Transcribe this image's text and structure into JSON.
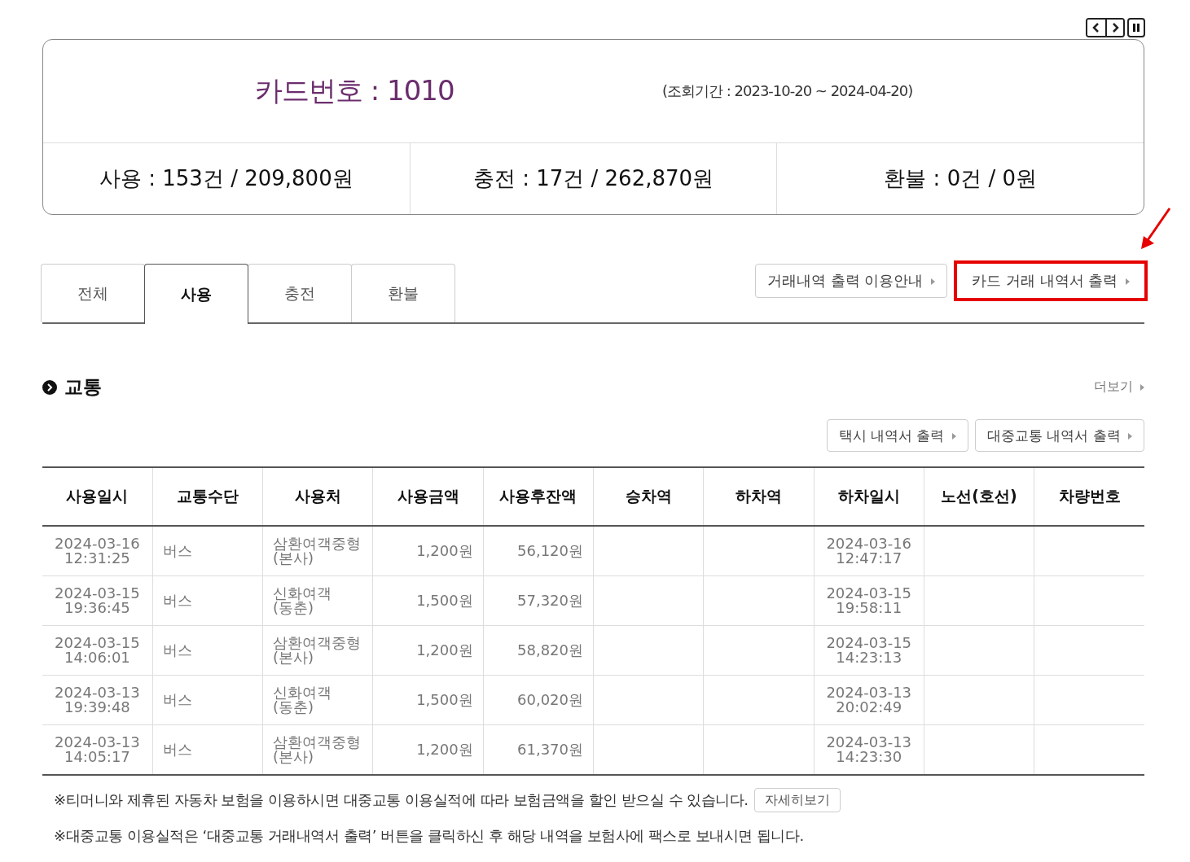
{
  "summary": {
    "card_label": "카드번호 : 1010",
    "period": "(조회기간 : 2023-10-20 ~ 2024-04-20)",
    "stats": [
      "사용 : 153건 / 209,800원",
      "충전 : 17건 / 262,870원",
      "환불 : 0건 / 0원"
    ]
  },
  "tabs": [
    {
      "label": "전체",
      "selected": false
    },
    {
      "label": "사용",
      "selected": true
    },
    {
      "label": "충전",
      "selected": false
    },
    {
      "label": "환불",
      "selected": false
    }
  ],
  "top_buttons": [
    {
      "label": "거래내역 출력 이용안내",
      "highlighted": false
    },
    {
      "label": "카드 거래 내역서 출력",
      "highlighted": true
    }
  ],
  "section": {
    "title": "교통",
    "more": "더보기"
  },
  "print_buttons": [
    "택시 내역서 출력",
    "대중교통 내역서 출력"
  ],
  "table": {
    "columns": [
      "사용일시",
      "교통수단",
      "사용처",
      "사용금액",
      "사용후잔액",
      "승차역",
      "하차역",
      "하차일시",
      "노선(호선)",
      "차량번호"
    ],
    "rows": [
      [
        "2024-03-16\n12:31:25",
        "버스",
        "삼환여객중형\n(본사)",
        "1,200원",
        "56,120원",
        "",
        "",
        "2024-03-16\n12:47:17",
        "",
        ""
      ],
      [
        "2024-03-15\n19:36:45",
        "버스",
        "신화여객\n(동춘)",
        "1,500원",
        "57,320원",
        "",
        "",
        "2024-03-15\n19:58:11",
        "",
        ""
      ],
      [
        "2024-03-15\n14:06:01",
        "버스",
        "삼환여객중형\n(본사)",
        "1,200원",
        "58,820원",
        "",
        "",
        "2024-03-15\n14:23:13",
        "",
        ""
      ],
      [
        "2024-03-13\n19:39:48",
        "버스",
        "신화여객\n(동춘)",
        "1,500원",
        "60,020원",
        "",
        "",
        "2024-03-13\n20:02:49",
        "",
        ""
      ],
      [
        "2024-03-13\n14:05:17",
        "버스",
        "삼환여객중형\n(본사)",
        "1,200원",
        "61,370원",
        "",
        "",
        "2024-03-13\n14:23:30",
        "",
        ""
      ]
    ]
  },
  "notes": [
    {
      "text": "※티머니와 제휴된 자동차 보험을 이용하시면 대중교통 이용실적에 따라 보험금액을 할인 받으실 수 있습니다.",
      "button": "자세히보기"
    },
    {
      "text": "※대중교통 이용실적은 ‘대중교통 거래내역서 출력’ 버튼을 클릭하신 후 해당 내역을 보험사에 팩스로 보내시면 됩니다."
    }
  ]
}
